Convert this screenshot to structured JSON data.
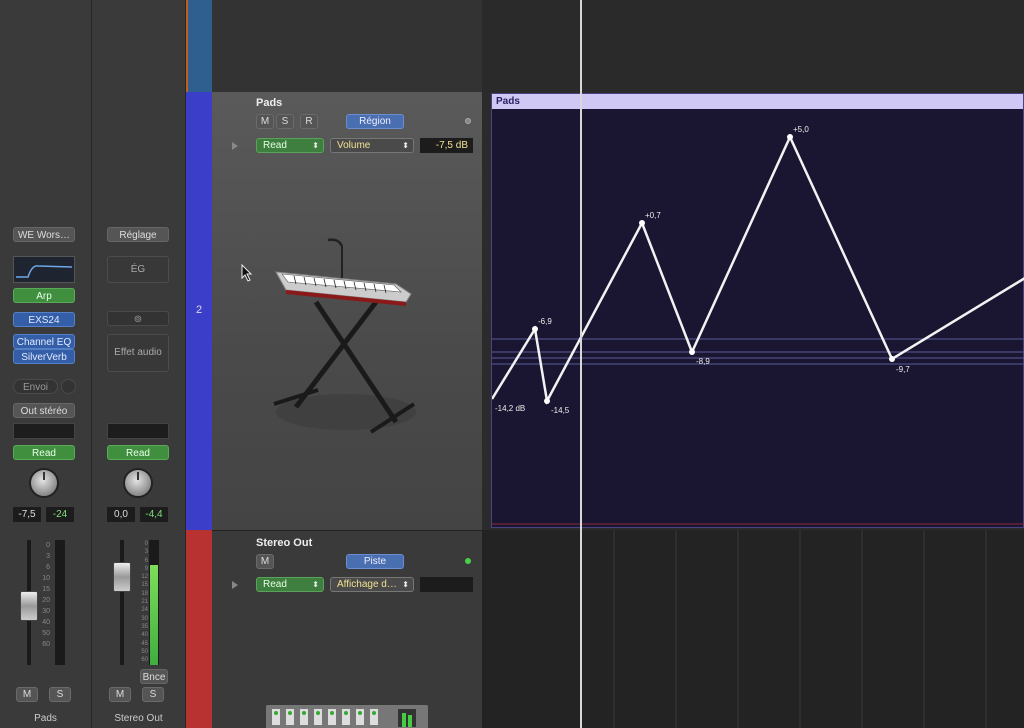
{
  "mixer": {
    "strip1": {
      "name": "Pads",
      "setting": "WE Wors…",
      "midi_fx": "Arp",
      "instrument": "EXS24",
      "inserts": [
        "Channel EQ",
        "SilverVerb"
      ],
      "send_label": "Envoi",
      "output": "Out stéréo",
      "automation": "Read",
      "volume_value": "-7,5",
      "peak_value": "-24",
      "mute": "M",
      "solo": "S",
      "scale": [
        "0",
        "3",
        "6",
        "10",
        "15",
        "20",
        "30",
        "40",
        "50",
        "60"
      ]
    },
    "strip2": {
      "name": "Stereo Out",
      "setting": "Réglage",
      "eq": "ÉG",
      "audio_fx": "Effet audio",
      "automation": "Read",
      "volume_value": "0,0",
      "peak_value": "-4,4",
      "bounce": "Bnce",
      "mute": "M",
      "solo": "S",
      "scale": [
        "0",
        "3",
        "6",
        "9",
        "12",
        "15",
        "18",
        "21",
        "24",
        "30",
        "35",
        "40",
        "45",
        "50",
        "60"
      ],
      "meter_level": 0.8
    }
  },
  "tracks": {
    "pads": {
      "number": "2",
      "name": "Pads",
      "mute": "M",
      "solo": "S",
      "record": "R",
      "region_button": "Région",
      "automation_mode": "Read",
      "parameter": "Volume",
      "value": "-7,5 dB",
      "color": "#3a3ec8"
    },
    "stereo_out": {
      "name": "Stereo Out",
      "mute": "M",
      "track_button": "Piste",
      "automation_mode": "Read",
      "parameter": "Affichage d…",
      "color": "#b83232"
    }
  },
  "region": {
    "name": "Pads",
    "automation_labels": [
      "-14,2 dB",
      "-6,9",
      "-14,5",
      "+0,7",
      "-8,9",
      "+5,0",
      "-9,7"
    ]
  },
  "colors": {
    "pads_track": "#3a3ec8",
    "stereo_track": "#b83232",
    "top_track": "#2f5f8f",
    "region_header": "#cfc8f5",
    "region_body": "#1a1530"
  }
}
